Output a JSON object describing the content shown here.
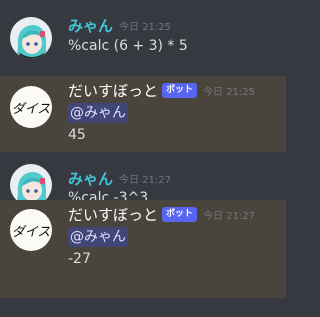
{
  "messages": [
    {
      "author": "みゃん",
      "timestamp": "今日 21:25",
      "content": "%calc (6 + 3) * 5",
      "avatar_icon": "anime-girl-avatar"
    },
    {
      "author": "だいすぼっと",
      "badge": "ボット",
      "timestamp": "今日 21:25",
      "mention": "@みゃん",
      "content": "45",
      "avatar_icon": "daisu-logo-avatar",
      "avatar_text": "ダイス"
    },
    {
      "author": "みゃん",
      "timestamp": "今日 21:27",
      "content": "%calc -3^3",
      "avatar_icon": "anime-girl-avatar"
    },
    {
      "author": "だいすぼっと",
      "badge": "ボット",
      "timestamp": "今日 21:27",
      "mention": "@みゃん",
      "content": "-27",
      "avatar_icon": "daisu-logo-avatar",
      "avatar_text": "ダイス"
    }
  ],
  "colors": {
    "background": "#36393f",
    "highlight": "#49443c",
    "user_name": "#3fc5d6",
    "bot_badge": "#5865f2",
    "mention_bg": "#404675"
  }
}
